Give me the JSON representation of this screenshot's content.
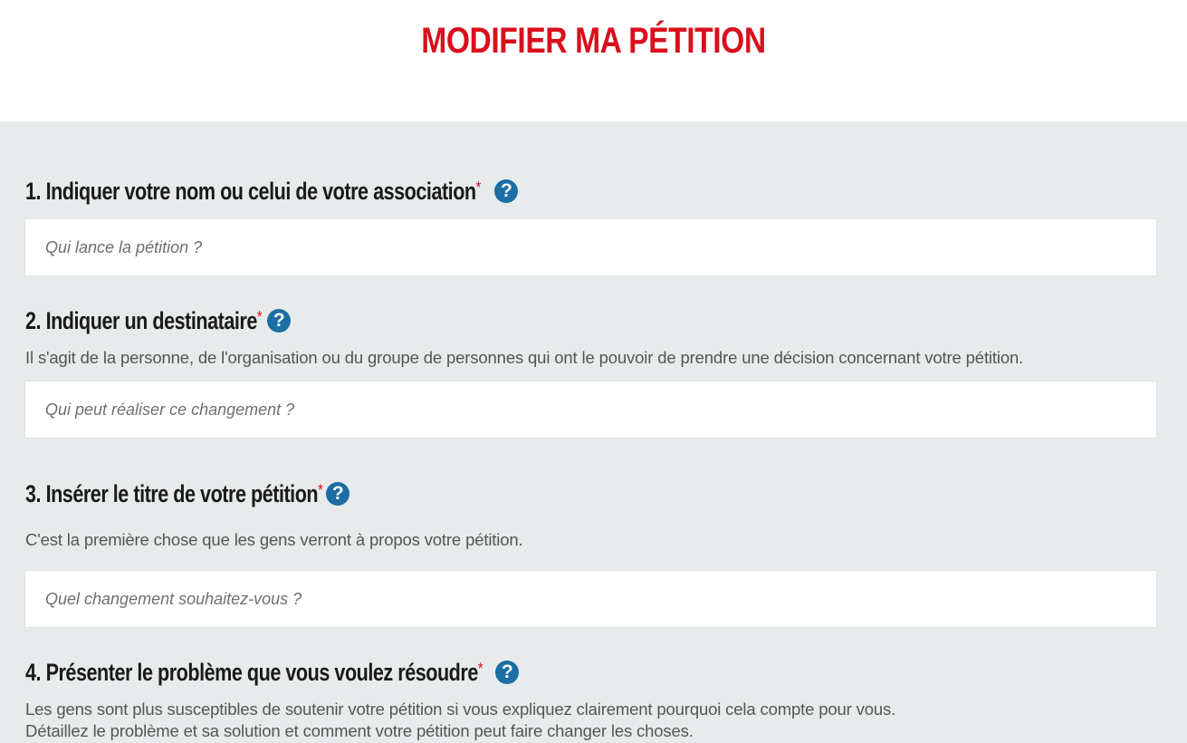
{
  "page": {
    "title": "MODIFIER MA PÉTITION"
  },
  "steps": [
    {
      "title": "1. Indiquer votre nom ou celui de votre association",
      "required_mark": "*",
      "help_icon": "question-circle-icon",
      "help_glyph": "?",
      "field": {
        "value": "",
        "placeholder": "Qui lance la pétition ?"
      }
    },
    {
      "title": "2. Indiquer un destinataire",
      "required_mark": "*",
      "help_icon": "question-circle-icon",
      "help_glyph": "?",
      "description": "Il s'agit de la personne, de l'organisation ou du groupe de personnes qui ont le pouvoir de prendre une décision concernant votre pétition.",
      "field": {
        "value": "",
        "placeholder": "Qui peut réaliser ce changement ?"
      }
    },
    {
      "title": "3. Insérer le titre de votre pétition",
      "required_mark": "*",
      "help_icon": "question-circle-icon",
      "help_glyph": "?",
      "description": "C'est la première chose que les gens verront à propos votre pétition.",
      "field": {
        "value": "",
        "placeholder": "Quel changement souhaitez-vous ?"
      }
    },
    {
      "title": "4. Présenter le problème que vous voulez résoudre",
      "required_mark": "*",
      "help_icon": "question-circle-icon",
      "help_glyph": "?",
      "description_lines": [
        "Les gens sont plus susceptibles de soutenir votre pétition si vous expliquez clairement pourquoi cela compte pour vous.",
        "Détaillez le problème et sa solution et comment votre pétition peut faire changer les choses."
      ]
    }
  ],
  "colors": {
    "title_red": "#d9101c",
    "form_background": "#e7ebec",
    "help_icon_blue": "#1c6ea4",
    "heading_text": "#1a1a1a",
    "description_text": "#555555"
  }
}
